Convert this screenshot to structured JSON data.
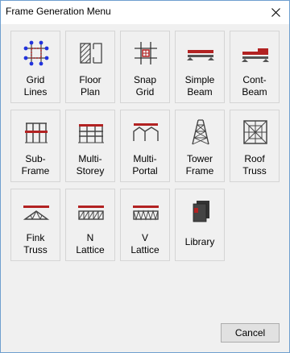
{
  "window": {
    "title": "Frame Generation Menu"
  },
  "colors": {
    "accent_red": "#b22222",
    "icon_dark": "#404040",
    "node_blue": "#2233dd"
  },
  "tiles": [
    {
      "label_line1": "Grid",
      "label_line2": "Lines",
      "icon": "grid-lines-icon"
    },
    {
      "label_line1": "Floor",
      "label_line2": "Plan",
      "icon": "floor-plan-icon"
    },
    {
      "label_line1": "Snap",
      "label_line2": "Grid",
      "icon": "snap-grid-icon"
    },
    {
      "label_line1": "Simple",
      "label_line2": "Beam",
      "icon": "simple-beam-icon"
    },
    {
      "label_line1": "Cont-",
      "label_line2": "Beam",
      "icon": "cont-beam-icon"
    },
    {
      "label_line1": "Sub-",
      "label_line2": "Frame",
      "icon": "sub-frame-icon"
    },
    {
      "label_line1": "Multi-",
      "label_line2": "Storey",
      "icon": "multi-storey-icon"
    },
    {
      "label_line1": "Multi-",
      "label_line2": "Portal",
      "icon": "multi-portal-icon"
    },
    {
      "label_line1": "Tower",
      "label_line2": "Frame",
      "icon": "tower-frame-icon"
    },
    {
      "label_line1": "Roof",
      "label_line2": "Truss",
      "icon": "roof-truss-icon"
    },
    {
      "label_line1": "Fink",
      "label_line2": "Truss",
      "icon": "fink-truss-icon"
    },
    {
      "label_line1": "N",
      "label_line2": "Lattice",
      "icon": "n-lattice-icon"
    },
    {
      "label_line1": "V",
      "label_line2": "Lattice",
      "icon": "v-lattice-icon"
    },
    {
      "label_line1": "Library",
      "icon": "library-icon"
    }
  ],
  "buttons": {
    "cancel": "Cancel"
  }
}
